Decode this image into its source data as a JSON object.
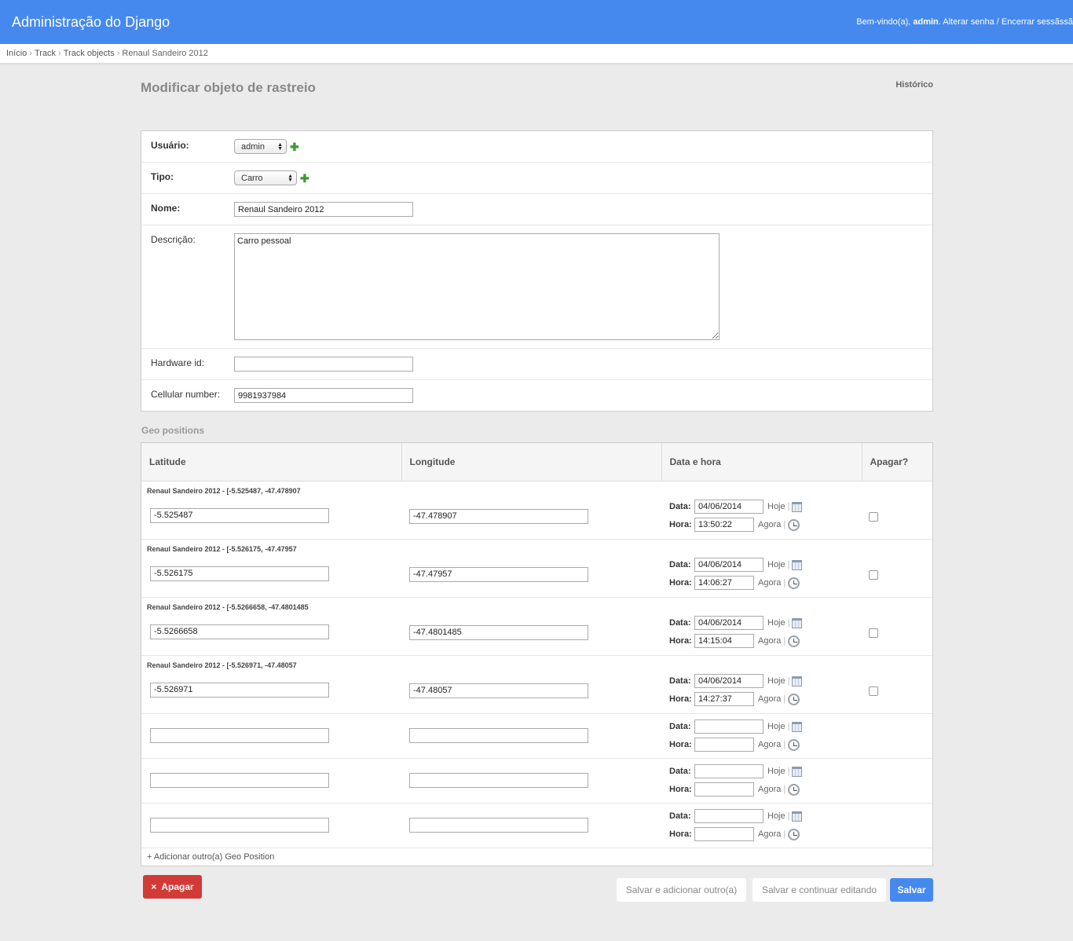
{
  "header": {
    "site_name": "Administração do Django",
    "welcome": "Bem-vindo(a),",
    "user": "admin",
    "change_password": "Alterar senha",
    "separator": "/",
    "logout": "Encerrar sessãssã"
  },
  "breadcrumbs": [
    "Início",
    "Track",
    "Track objects",
    "Renaul Sandeiro 2012"
  ],
  "page": {
    "title": "Modificar objeto de rastreio",
    "history": "Histórico"
  },
  "form": {
    "usuario": {
      "label": "Usuário:",
      "value": "admin"
    },
    "tipo": {
      "label": "Tipo:",
      "value": "Carro"
    },
    "nome": {
      "label": "Nome:",
      "value": "Renaul Sandeiro 2012"
    },
    "descricao": {
      "label": "Descrição:",
      "value": "Carro pessoal"
    },
    "hardware_id": {
      "label": "Hardware id:",
      "value": ""
    },
    "cellular": {
      "label": "Cellular number:",
      "value": "9981937984"
    }
  },
  "inline": {
    "title": "Geo positions",
    "columns": [
      "Latitude",
      "Longitude",
      "Data e hora",
      "Apagar?"
    ],
    "date_label": "Data:",
    "time_label": "Hora:",
    "today": "Hoje",
    "now": "Agora",
    "pipe": "|",
    "rows": [
      {
        "original": "Renaul Sandeiro 2012 - [-5.525487, -47.478907",
        "lat": "-5.525487",
        "lng": "-47.478907",
        "date": "04/06/2014",
        "time": "13:50:22"
      },
      {
        "original": "Renaul Sandeiro 2012 - [-5.526175, -47.47957",
        "lat": "-5.526175",
        "lng": "-47.47957",
        "date": "04/06/2014",
        "time": "14:06:27"
      },
      {
        "original": "Renaul Sandeiro 2012 - [-5.5266658, -47.4801485",
        "lat": "-5.5266658",
        "lng": "-47.4801485",
        "date": "04/06/2014",
        "time": "14:15:04"
      },
      {
        "original": "Renaul Sandeiro 2012 - [-5.526971, -47.48057",
        "lat": "-5.526971",
        "lng": "-47.48057",
        "date": "04/06/2014",
        "time": "14:27:37"
      }
    ],
    "empty_rows": 3,
    "add_another": "Adicionar outro(a) Geo Position",
    "add_sign": "+"
  },
  "submit": {
    "delete": "Apagar",
    "delete_icon": "×",
    "save_add": "Salvar e adicionar outro(a)",
    "save_continue": "Salvar e continuar editando",
    "save": "Salvar"
  },
  "colors": {
    "header": "#4589ef",
    "delete": "#d13a36",
    "add_icon": "#3a9a30"
  }
}
